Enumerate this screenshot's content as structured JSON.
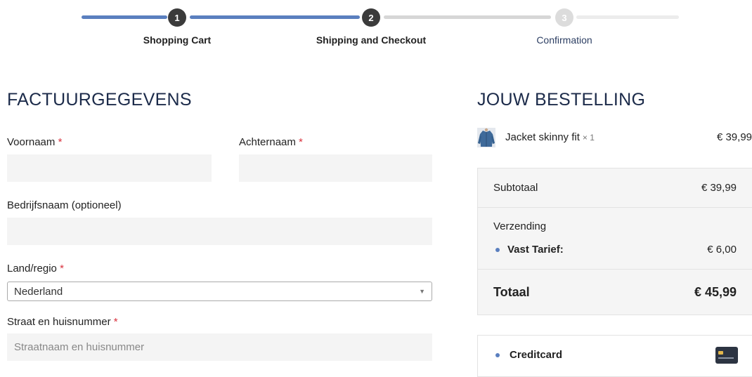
{
  "steps": [
    {
      "number": "1",
      "label": "Shopping Cart",
      "state": "done"
    },
    {
      "number": "2",
      "label": "Shipping and Checkout",
      "state": "current"
    },
    {
      "number": "3",
      "label": "Confirmation",
      "state": "todo"
    }
  ],
  "billing": {
    "title": "FACTUURGEGEVENS",
    "required_marker": "*",
    "first_name": {
      "label": "Voornaam",
      "value": ""
    },
    "last_name": {
      "label": "Achternaam",
      "value": ""
    },
    "company": {
      "label": "Bedrijfsnaam (optioneel)",
      "value": ""
    },
    "country": {
      "label": "Land/regio",
      "selected": "Nederland"
    },
    "street": {
      "label": "Straat en huisnummer",
      "placeholder": "Straatnaam en huisnummer"
    }
  },
  "order": {
    "title": "JOUW BESTELLING",
    "product": {
      "name": "Jacket skinny fit",
      "qty": "× 1",
      "price": "€ 39,99",
      "image": "jacket-thumbnail"
    },
    "subtotal": {
      "label": "Subtotaal",
      "value": "€ 39,99"
    },
    "shipping": {
      "label": "Verzending",
      "method": "Vast Tarief:",
      "value": "€ 6,00"
    },
    "total": {
      "label": "Totaal",
      "value": "€ 45,99"
    },
    "payment": {
      "method": "Creditcard",
      "icon": "credit-card-icon"
    }
  },
  "colors": {
    "accent": "#5a7fbf",
    "heading": "#1c2b4a",
    "required": "#d9333f"
  }
}
